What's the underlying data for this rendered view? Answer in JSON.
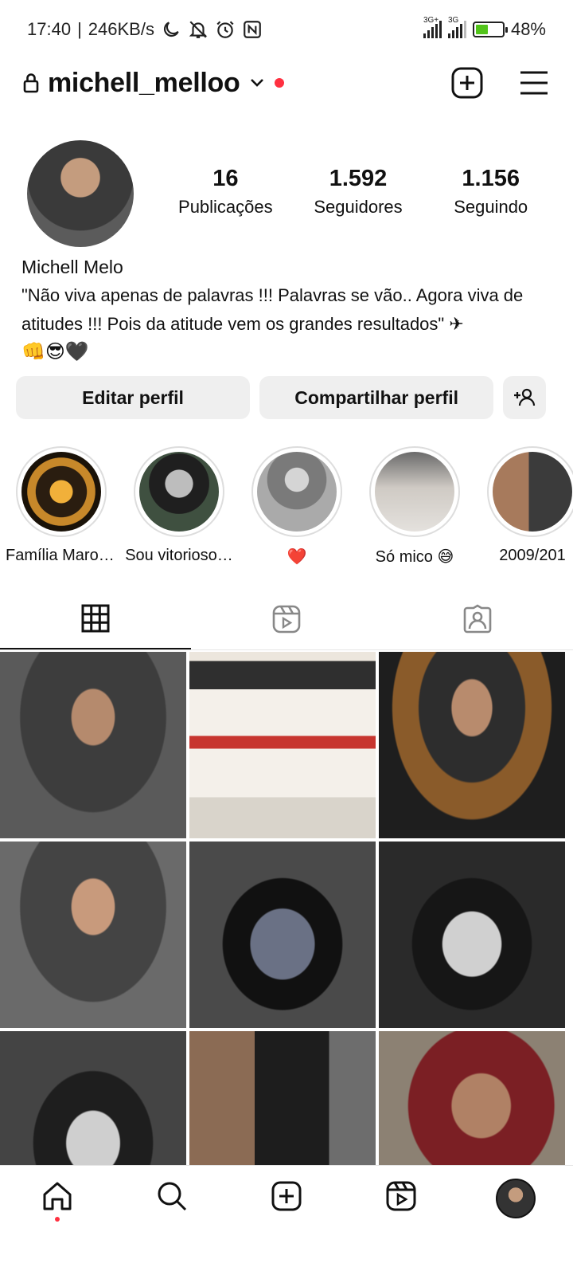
{
  "status_bar": {
    "time": "17:40",
    "speed": "246KB/s",
    "network_1": "3G+",
    "network_2": "3G",
    "battery": "48%",
    "battery_level": 0.48,
    "icons": [
      "moon-icon",
      "bell-off-icon",
      "alarm-icon",
      "nfc-icon"
    ]
  },
  "header": {
    "username": "michell_melloo",
    "icons": [
      "lock-icon",
      "chevron-down-icon",
      "notification-dot",
      "new-post-icon",
      "menu-icon"
    ]
  },
  "profile": {
    "stats": [
      {
        "value": "16",
        "label": "Publicações"
      },
      {
        "value": "1.592",
        "label": "Seguidores"
      },
      {
        "value": "1.156",
        "label": "Seguindo"
      }
    ],
    "name": "Michell Melo",
    "bio": "\"Não viva apenas de palavras !!! Palavras se vão..  Agora viva de atitudes !!! Pois da atitude vem os grandes resultados\" ✈",
    "bio_emoji": "👊😎🖤"
  },
  "buttons": {
    "edit": "Editar perfil",
    "share": "Compartilhar perfil"
  },
  "highlights": [
    {
      "label": "Família Marot…",
      "color": "#d89a2a"
    },
    {
      "label": "Sou vitorioso…",
      "color": "#3b3b3b"
    },
    {
      "label": "❤️",
      "color": "#8a8a8a"
    },
    {
      "label": "Só mico 😅",
      "color": "#b9b6b2"
    },
    {
      "label": "2009/201",
      "color": "#6b5a4c"
    }
  ],
  "tabs": [
    "grid-icon",
    "reels-icon",
    "tagged-icon"
  ],
  "grid_colors": [
    "#4a4a4a",
    "#e9e3da",
    "#5a5a5a",
    "#6e6e6e",
    "#2d2d2d",
    "#1d1d1d",
    "#3a3a3a",
    "#8a7763",
    "#9a8a78"
  ],
  "bottom_nav": [
    "home-icon",
    "search-icon",
    "create-icon",
    "reels-icon",
    "profile-avatar"
  ]
}
